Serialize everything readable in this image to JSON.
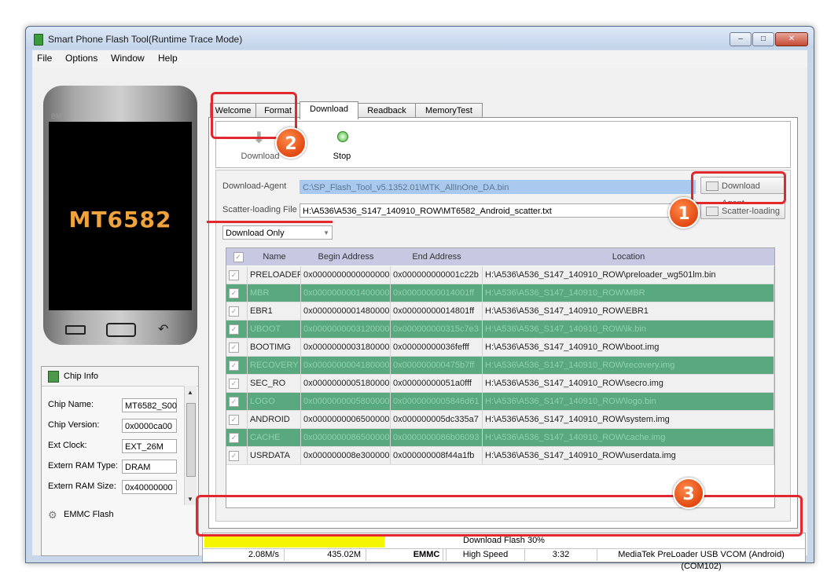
{
  "window": {
    "title": "Smart Phone Flash Tool(Runtime Trace Mode)"
  },
  "menu": [
    "File",
    "Options",
    "Window",
    "Help"
  ],
  "phone": {
    "brand": "BM",
    "chip": "MT6582"
  },
  "chip_info": {
    "title": "Chip Info",
    "rows": [
      {
        "label": "Chip Name:",
        "value": "MT6582_S00"
      },
      {
        "label": "Chip Version:",
        "value": "0x0000ca00"
      },
      {
        "label": "Ext Clock:",
        "value": "EXT_26M"
      },
      {
        "label": "Extern RAM Type:",
        "value": "DRAM"
      },
      {
        "label": "Extern RAM Size:",
        "value": "0x40000000"
      }
    ],
    "footer": "EMMC Flash"
  },
  "tabs": [
    "Welcome",
    "Format",
    "Download",
    "Readback",
    "MemoryTest"
  ],
  "active_tab": "Download",
  "toolbar": {
    "download_label": "Download",
    "stop_label": "Stop"
  },
  "form": {
    "download_agent_label": "Download-Agent",
    "download_agent_value": "C:\\SP_Flash_Tool_v5.1352.01\\MTK_AllInOne_DA.bin",
    "download_agent_button": "Download Agent",
    "scatter_label": "Scatter-loading File",
    "scatter_value": "H:\\A536\\A536_S147_140910_ROW\\MT6582_Android_scatter.txt",
    "scatter_button": "Scatter-loading",
    "mode_value": "Download Only"
  },
  "table": {
    "headers": [
      "",
      "Name",
      "Begin Address",
      "End Address",
      "Location"
    ],
    "rows": [
      {
        "name": "PRELOADER",
        "begin": "0x0000000000000000",
        "end": "0x000000000001c22b",
        "location": "H:\\A536\\A536_S147_140910_ROW\\preloader_wg501lm.bin",
        "style": "light"
      },
      {
        "name": "MBR",
        "begin": "0x0000000001400000",
        "end": "0x00000000014001ff",
        "location": "H:\\A536\\A536_S147_140910_ROW\\MBR",
        "style": "dark"
      },
      {
        "name": "EBR1",
        "begin": "0x0000000001480000",
        "end": "0x00000000014801ff",
        "location": "H:\\A536\\A536_S147_140910_ROW\\EBR1",
        "style": "light"
      },
      {
        "name": "UBOOT",
        "begin": "0x0000000003120000",
        "end": "0x000000000315c7e3",
        "location": "H:\\A536\\A536_S147_140910_ROW\\lk.bin",
        "style": "dark"
      },
      {
        "name": "BOOTIMG",
        "begin": "0x0000000003180000",
        "end": "0x00000000036fefff",
        "location": "H:\\A536\\A536_S147_140910_ROW\\boot.img",
        "style": "light"
      },
      {
        "name": "RECOVERY",
        "begin": "0x0000000004180000",
        "end": "0x000000000475b7ff",
        "location": "H:\\A536\\A536_S147_140910_ROW\\recovery.img",
        "style": "dark"
      },
      {
        "name": "SEC_RO",
        "begin": "0x0000000005180000",
        "end": "0x00000000051a0fff",
        "location": "H:\\A536\\A536_S147_140910_ROW\\secro.img",
        "style": "light"
      },
      {
        "name": "LOGO",
        "begin": "0x0000000005800000",
        "end": "0x0000000005846d61",
        "location": "H:\\A536\\A536_S147_140910_ROW\\logo.bin",
        "style": "dark"
      },
      {
        "name": "ANDROID",
        "begin": "0x0000000006500000",
        "end": "0x000000005dc335a7",
        "location": "H:\\A536\\A536_S147_140910_ROW\\system.img",
        "style": "light"
      },
      {
        "name": "CACHE",
        "begin": "0x0000000086500000",
        "end": "0x0000000086b06093",
        "location": "H:\\A536\\A536_S147_140910_ROW\\cache.img",
        "style": "dark"
      },
      {
        "name": "USRDATA",
        "begin": "0x000000008e300000",
        "end": "0x000000008f44a1fb",
        "location": "H:\\A536\\A536_S147_140910_ROW\\userdata.img",
        "style": "light"
      }
    ]
  },
  "status": {
    "progress_text": "Download Flash 30%",
    "progress_fraction": 0.3,
    "speed": "2.08M/s",
    "size": "435.02M",
    "storage": "EMMC",
    "speed_mode": "High Speed",
    "time": "3:32",
    "port": "MediaTek PreLoader USB VCOM (Android) (COM102)"
  },
  "badges": [
    "1",
    "2",
    "3"
  ],
  "colors": {
    "progress": "#f5f500",
    "annotation": "#e0282e",
    "row_dark": "#5aa97e"
  }
}
